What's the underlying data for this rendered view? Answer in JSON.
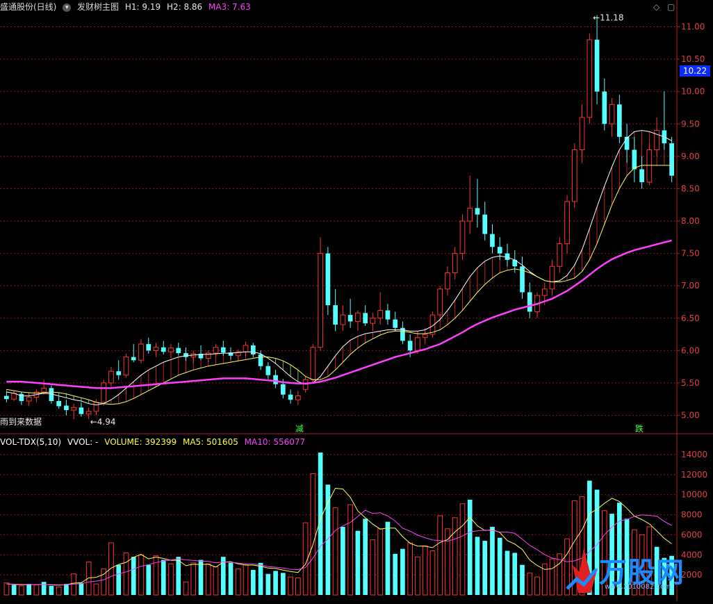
{
  "header": {
    "stock_name": "盛通股份(日线)",
    "indicator_icon": "chevron-down-icon",
    "indicator_name": "发财树主图",
    "h1": "H1: 9.19",
    "h2": "H2: 8.86",
    "ma3": "MA3: 7.63",
    "controls": [
      "◇",
      "▢"
    ]
  },
  "vol_header": {
    "name": "VOL-TDX(5,10)",
    "vvol": "VVOL: -",
    "volume": "VOLUME: 392399",
    "ma5": "MA5: 501605",
    "ma10": "MA10: 556077"
  },
  "price_box": "10.22",
  "markers": {
    "high": "11.18",
    "low": "4.94",
    "no_data_text": "雨到来数据",
    "reduce": "减",
    "drop": "跌"
  },
  "logo": {
    "main": "万股网",
    "sub": "www.2010082.com"
  },
  "colors": {
    "up": "#ff3232",
    "down": "#54ffff",
    "ma_fast": "#ffffff",
    "ma_mid": "#ffff60",
    "ma_long": "#ff40ff",
    "grid": "#8b1a1a",
    "bg": "#000000"
  },
  "chart_data": [
    {
      "type": "candlestick",
      "title": "发财树主图",
      "y_ticks": [
        "11.00",
        "10.50",
        "10.00",
        "9.50",
        "9.00",
        "8.50",
        "8.00",
        "7.50",
        "7.00",
        "6.50",
        "6.00",
        "5.50",
        "5.00"
      ],
      "ylim": [
        4.75,
        11.3
      ],
      "candles": [
        [
          5.3,
          5.36,
          5.2,
          5.25
        ],
        [
          5.25,
          5.38,
          5.22,
          5.34
        ],
        [
          5.33,
          5.36,
          5.16,
          5.22
        ],
        [
          5.22,
          5.32,
          5.14,
          5.28
        ],
        [
          5.28,
          5.4,
          5.2,
          5.36
        ],
        [
          5.36,
          5.55,
          5.32,
          5.42
        ],
        [
          5.42,
          5.46,
          5.18,
          5.22
        ],
        [
          5.22,
          5.3,
          5.1,
          5.14
        ],
        [
          5.15,
          5.24,
          5.0,
          5.08
        ],
        [
          5.08,
          5.18,
          4.94,
          5.12
        ],
        [
          5.12,
          5.2,
          4.98,
          5.02
        ],
        [
          5.02,
          5.12,
          4.94,
          5.06
        ],
        [
          5.06,
          5.25,
          5.0,
          5.2
        ],
        [
          5.2,
          5.55,
          5.15,
          5.5
        ],
        [
          5.5,
          5.75,
          5.44,
          5.68
        ],
        [
          5.68,
          5.85,
          5.55,
          5.62
        ],
        [
          5.62,
          5.95,
          5.58,
          5.9
        ],
        [
          5.9,
          6.1,
          5.82,
          5.85
        ],
        [
          5.85,
          6.18,
          5.8,
          6.1
        ],
        [
          6.1,
          6.2,
          5.95,
          6.0
        ],
        [
          6.0,
          6.12,
          5.9,
          6.05
        ],
        [
          6.05,
          6.15,
          5.94,
          5.98
        ],
        [
          5.98,
          6.1,
          5.88,
          6.04
        ],
        [
          6.04,
          6.12,
          5.92,
          5.96
        ],
        [
          5.96,
          6.05,
          5.84,
          5.9
        ],
        [
          5.9,
          6.0,
          5.8,
          5.95
        ],
        [
          5.95,
          6.08,
          5.85,
          5.88
        ],
        [
          5.88,
          6.0,
          5.82,
          5.96
        ],
        [
          5.96,
          6.1,
          5.9,
          6.05
        ],
        [
          6.05,
          6.15,
          5.92,
          5.97
        ],
        [
          5.97,
          6.05,
          5.86,
          5.92
        ],
        [
          5.92,
          6.02,
          5.84,
          5.98
        ],
        [
          5.98,
          6.14,
          5.92,
          6.08
        ],
        [
          6.08,
          6.12,
          5.9,
          5.94
        ],
        [
          5.94,
          6.0,
          5.7,
          5.76
        ],
        [
          5.76,
          5.82,
          5.56,
          5.62
        ],
        [
          5.62,
          5.7,
          5.42,
          5.48
        ],
        [
          5.48,
          5.56,
          5.26,
          5.32
        ],
        [
          5.32,
          5.4,
          5.18,
          5.24
        ],
        [
          5.24,
          5.38,
          5.16,
          5.3
        ],
        [
          5.4,
          5.6,
          5.35,
          5.55
        ],
        [
          5.55,
          6.1,
          5.5,
          6.05
        ],
        [
          6.05,
          7.75,
          6.0,
          7.5
        ],
        [
          7.5,
          7.6,
          6.55,
          6.7
        ],
        [
          6.7,
          6.95,
          6.3,
          6.4
        ],
        [
          6.4,
          6.7,
          6.3,
          6.55
        ],
        [
          6.55,
          6.8,
          6.35,
          6.45
        ],
        [
          6.45,
          6.62,
          6.3,
          6.58
        ],
        [
          6.58,
          6.7,
          6.38,
          6.42
        ],
        [
          6.42,
          6.58,
          6.3,
          6.5
        ],
        [
          6.5,
          6.9,
          6.4,
          6.62
        ],
        [
          6.62,
          6.72,
          6.4,
          6.48
        ],
        [
          6.48,
          6.6,
          6.3,
          6.35
        ],
        [
          6.35,
          6.45,
          6.1,
          6.15
        ],
        [
          6.15,
          6.25,
          5.9,
          6.0
        ],
        [
          6.0,
          6.3,
          5.95,
          6.2
        ],
        [
          6.2,
          6.35,
          6.1,
          6.25
        ],
        [
          6.25,
          6.6,
          6.2,
          6.55
        ],
        [
          6.55,
          7.0,
          6.45,
          6.95
        ],
        [
          6.95,
          7.3,
          6.85,
          7.2
        ],
        [
          7.2,
          7.6,
          7.1,
          7.5
        ],
        [
          7.5,
          8.1,
          7.4,
          8.0
        ],
        [
          8.0,
          8.7,
          7.8,
          8.2
        ],
        [
          8.2,
          8.65,
          7.9,
          8.1
        ],
        [
          8.1,
          8.3,
          7.7,
          7.8
        ],
        [
          7.8,
          7.95,
          7.5,
          7.6
        ],
        [
          7.6,
          7.75,
          7.4,
          7.5
        ],
        [
          7.5,
          7.65,
          7.3,
          7.4
        ],
        [
          7.4,
          7.55,
          7.2,
          7.3
        ],
        [
          7.3,
          7.45,
          6.8,
          6.9
        ],
        [
          6.9,
          7.05,
          6.5,
          6.6
        ],
        [
          6.6,
          6.9,
          6.5,
          6.85
        ],
        [
          6.85,
          7.05,
          6.7,
          6.95
        ],
        [
          6.95,
          7.4,
          6.85,
          7.3
        ],
        [
          7.3,
          7.75,
          7.2,
          7.65
        ],
        [
          7.65,
          8.4,
          7.5,
          8.3
        ],
        [
          8.3,
          9.2,
          8.2,
          9.1
        ],
        [
          9.1,
          9.8,
          8.9,
          9.6
        ],
        [
          9.6,
          10.9,
          9.5,
          10.8
        ],
        [
          10.8,
          11.18,
          9.8,
          10.0
        ],
        [
          10.0,
          10.2,
          9.4,
          9.5
        ],
        [
          9.5,
          9.9,
          9.3,
          9.8
        ],
        [
          9.8,
          9.95,
          9.2,
          9.3
        ],
        [
          9.3,
          9.5,
          8.9,
          9.1
        ],
        [
          9.1,
          9.3,
          8.6,
          8.8
        ],
        [
          8.8,
          9.0,
          8.5,
          8.6
        ],
        [
          8.6,
          9.2,
          8.55,
          9.1
        ],
        [
          9.1,
          9.6,
          9.0,
          9.4
        ],
        [
          9.4,
          10.0,
          9.1,
          9.2
        ],
        [
          9.2,
          9.3,
          8.6,
          8.7
        ]
      ],
      "series": [
        {
          "name": "MA3",
          "values": [
            5.36,
            5.34,
            5.3,
            5.3,
            5.32,
            5.34,
            5.33,
            5.3,
            5.27,
            5.24,
            5.22,
            5.18,
            5.16,
            5.18,
            5.24,
            5.32,
            5.42,
            5.52,
            5.62,
            5.7,
            5.76,
            5.82,
            5.86,
            5.9,
            5.92,
            5.93,
            5.94,
            5.94,
            5.95,
            5.96,
            5.96,
            5.97,
            5.98,
            5.98,
            5.95,
            5.88,
            5.8,
            5.7,
            5.6,
            5.52,
            5.48,
            5.5,
            5.6,
            5.76,
            5.92,
            6.06,
            6.16,
            6.22,
            6.26,
            6.28,
            6.3,
            6.32,
            6.32,
            6.32,
            6.3,
            6.3,
            6.32,
            6.38,
            6.48,
            6.62,
            6.78,
            6.96,
            7.14,
            7.28,
            7.38,
            7.44,
            7.46,
            7.44,
            7.4,
            7.32,
            7.22,
            7.14,
            7.08,
            7.06,
            7.08,
            7.16,
            7.32,
            7.56,
            7.88,
            8.22,
            8.54,
            8.84,
            9.1,
            9.28,
            9.38,
            9.4,
            9.38,
            9.34,
            9.3,
            9.24
          ]
        },
        {
          "name": "",
          "values": [
            5.4,
            5.38,
            5.36,
            5.35,
            5.34,
            5.35,
            5.36,
            5.35,
            5.33,
            5.3,
            5.27,
            5.24,
            5.2,
            5.18,
            5.17,
            5.18,
            5.21,
            5.26,
            5.32,
            5.38,
            5.44,
            5.5,
            5.56,
            5.62,
            5.66,
            5.7,
            5.73,
            5.76,
            5.78,
            5.8,
            5.82,
            5.84,
            5.86,
            5.88,
            5.9,
            5.9,
            5.88,
            5.84,
            5.78,
            5.7,
            5.6,
            5.55,
            5.55,
            5.6,
            5.7,
            5.82,
            5.94,
            6.04,
            6.12,
            6.18,
            6.24,
            6.28,
            6.3,
            6.3,
            6.28,
            6.26,
            6.26,
            6.28,
            6.32,
            6.4,
            6.5,
            6.62,
            6.76,
            6.9,
            7.02,
            7.12,
            7.2,
            7.24,
            7.26,
            7.24,
            7.2,
            7.14,
            7.08,
            7.06,
            7.06,
            7.08,
            7.12,
            7.22,
            7.4,
            7.65,
            7.95,
            8.25,
            8.5,
            8.7,
            8.82,
            8.86,
            8.86,
            8.86,
            8.86,
            8.86
          ]
        },
        {
          "name": "",
          "values": [
            5.52,
            5.52,
            5.52,
            5.51,
            5.5,
            5.49,
            5.48,
            5.47,
            5.46,
            5.45,
            5.44,
            5.43,
            5.42,
            5.42,
            5.42,
            5.43,
            5.44,
            5.45,
            5.46,
            5.47,
            5.48,
            5.49,
            5.5,
            5.51,
            5.52,
            5.53,
            5.54,
            5.55,
            5.56,
            5.57,
            5.57,
            5.57,
            5.57,
            5.56,
            5.55,
            5.54,
            5.53,
            5.51,
            5.5,
            5.49,
            5.49,
            5.5,
            5.52,
            5.55,
            5.58,
            5.62,
            5.66,
            5.7,
            5.74,
            5.78,
            5.82,
            5.86,
            5.9,
            5.93,
            5.96,
            5.99,
            6.02,
            6.06,
            6.1,
            6.16,
            6.22,
            6.28,
            6.35,
            6.41,
            6.46,
            6.51,
            6.55,
            6.59,
            6.63,
            6.66,
            6.69,
            6.72,
            6.76,
            6.8,
            6.86,
            6.92,
            7.0,
            7.08,
            7.17,
            7.26,
            7.34,
            7.41,
            7.46,
            7.51,
            7.55,
            7.58,
            7.61,
            7.64,
            7.67,
            7.7
          ]
        }
      ]
    },
    {
      "type": "bar",
      "title": "VOL-TDX(5,10)",
      "y_ticks": [
        "14000",
        "12000",
        "10000",
        "8000",
        "6000",
        "4000",
        "2000"
      ],
      "ylim": [
        0,
        15000
      ],
      "values": [
        1200,
        1000,
        900,
        1100,
        1000,
        1300,
        900,
        800,
        1100,
        2100,
        1200,
        3300,
        1100,
        2600,
        5200,
        3000,
        4200,
        3800,
        4000,
        3000,
        3900,
        3500,
        3100,
        3800,
        1300,
        3200,
        3500,
        3100,
        2800,
        3800,
        3200,
        2600,
        3000,
        2500,
        3200,
        2100,
        2400,
        2200,
        1800,
        1700,
        7200,
        12100,
        14200,
        11000,
        8700,
        6800,
        9000,
        6400,
        7600,
        5500,
        6600,
        7300,
        4100,
        4600,
        5200,
        3800,
        4900,
        4400,
        7900,
        6600,
        7700,
        9100,
        9500,
        5800,
        5400,
        6800,
        5700,
        4400,
        4200,
        3000,
        2200,
        1800,
        3100,
        3600,
        4100,
        5600,
        9400,
        9800,
        11400,
        10500,
        8400,
        8100,
        9200,
        7600,
        6500,
        6000,
        6800,
        4800,
        3700,
        3900
      ],
      "up": [
        1,
        0,
        1,
        0,
        1,
        0,
        0,
        1,
        0,
        1,
        0,
        1,
        1,
        1,
        1,
        0,
        1,
        0,
        1,
        0,
        1,
        0,
        1,
        0,
        1,
        1,
        0,
        1,
        1,
        0,
        0,
        1,
        1,
        0,
        0,
        0,
        0,
        0,
        1,
        1,
        1,
        1,
        0,
        0,
        1,
        0,
        1,
        0,
        0,
        1,
        1,
        0,
        0,
        0,
        1,
        1,
        1,
        1,
        1,
        1,
        1,
        1,
        0,
        0,
        0,
        0,
        0,
        0,
        0,
        0,
        1,
        1,
        1,
        1,
        1,
        1,
        1,
        1,
        0,
        0,
        1,
        0,
        0,
        0,
        1,
        1,
        1,
        0,
        0,
        0
      ],
      "series": [
        {
          "name": "MA5",
          "values": [
            1100,
            1050,
            1020,
            1010,
            1040,
            1060,
            1000,
            980,
            1020,
            1180,
            1220,
            1700,
            1760,
            2060,
            2680,
            3040,
            3260,
            3760,
            4040,
            3600,
            3780,
            3640,
            3460,
            3460,
            2920,
            3060,
            3040,
            3060,
            2780,
            3280,
            3320,
            3100,
            2980,
            2980,
            2860,
            2680,
            2640,
            2480,
            2340,
            2240,
            3060,
            5040,
            7580,
            9220,
            10640,
            10560,
            9740,
            8380,
            7700,
            7060,
            6560,
            6680,
            6660,
            5820,
            5140,
            4880,
            4860,
            4720,
            5240,
            5520,
            6300,
            6900,
            7740,
            6900,
            6420,
            6500,
            6240,
            5420,
            5080,
            4540,
            3480,
            2940,
            2540,
            2620,
            3140,
            4080,
            5380,
            6500,
            8120,
            8540,
            9140,
            9640,
            9320,
            8640,
            7860,
            7520,
            7100,
            6380,
            5640,
            5100
          ]
        },
        {
          "name": "MA10",
          "values": [
            1100,
            1080,
            1060,
            1040,
            1030,
            1040,
            1030,
            1010,
            1020,
            1080,
            1120,
            1300,
            1380,
            1520,
            1860,
            2110,
            2300,
            2580,
            2860,
            3020,
            3240,
            3380,
            3490,
            3600,
            3500,
            3440,
            3380,
            3340,
            3210,
            3290,
            3260,
            3180,
            3110,
            3100,
            2980,
            2820,
            2770,
            2690,
            2560,
            2520,
            2740,
            3680,
            4860,
            5580,
            6440,
            6890,
            7230,
            7830,
            8440,
            8120,
            8190,
            7880,
            7380,
            6650,
            6360,
            5960,
            5710,
            5480,
            5420,
            5360,
            5580,
            5880,
            6300,
            6390,
            6450,
            6430,
            6280,
            6270,
            6140,
            5560,
            4940,
            4520,
            4010,
            3680,
            3520,
            3310,
            3400,
            3680,
            4310,
            5020,
            6000,
            6770,
            7380,
            7530,
            7830,
            7990,
            7930,
            7860,
            7330,
            6930
          ]
        }
      ]
    }
  ]
}
